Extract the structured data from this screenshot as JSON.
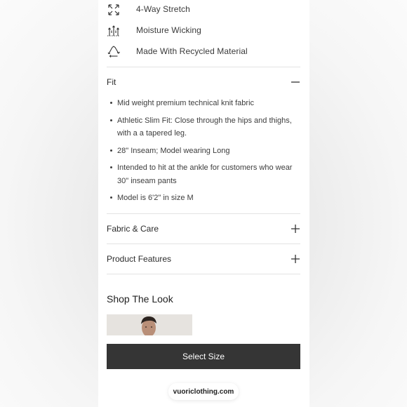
{
  "features": [
    {
      "icon": "arrows-expand-icon",
      "label": "4-Way Stretch"
    },
    {
      "icon": "moisture-wicking-icon",
      "label": "Moisture Wicking"
    },
    {
      "icon": "recycle-icon",
      "label": "Made With Recycled Material"
    }
  ],
  "fit": {
    "title": "Fit",
    "expanded": true,
    "bullets": [
      "Mid weight premium technical knit fabric",
      "Athletic Slim Fit: Close through the hips and thighs, with a a tapered leg.",
      "28\" Inseam; Model wearing Long",
      "Intended to hit at the ankle for customers who wear 30\" inseam pants",
      "Model is 6'2\" in size M"
    ]
  },
  "fabric_care": {
    "title": "Fabric & Care",
    "expanded": false
  },
  "product_features": {
    "title": "Product Features",
    "expanded": false
  },
  "shop_the_look": {
    "title": "Shop The Look"
  },
  "select_size": {
    "label": "Select Size"
  },
  "browser": {
    "url": "vuoriclothing.com"
  },
  "colors": {
    "button_bg": "#353535",
    "divider": "#e3e3e3",
    "text": "#2a2a2a"
  }
}
